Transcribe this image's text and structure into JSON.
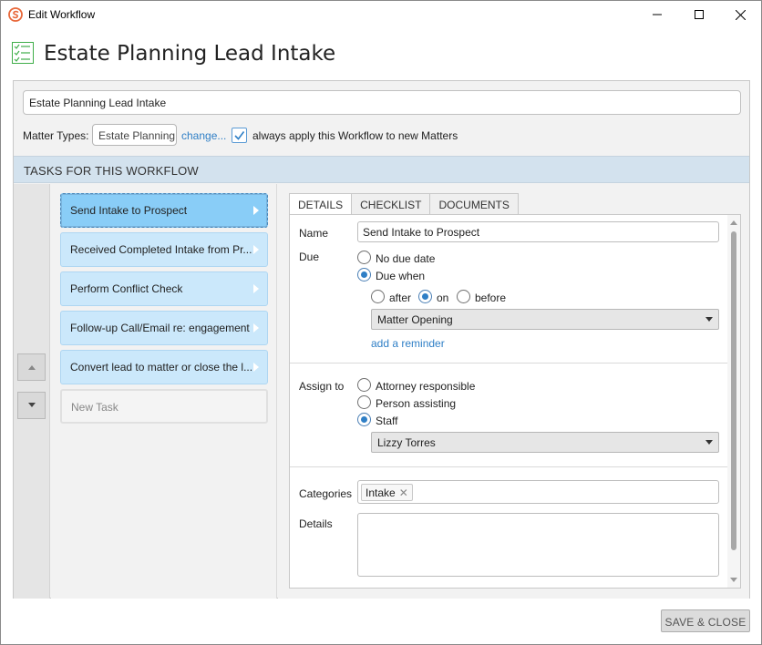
{
  "window": {
    "title": "Edit Workflow"
  },
  "header": {
    "title": "Estate Planning Lead Intake"
  },
  "workflow": {
    "name_value": "Estate Planning Lead Intake",
    "matter_types_label": "Matter Types:",
    "matter_types_value": "Estate Planning",
    "change_link": "change...",
    "always_apply_checked": true,
    "always_apply_label": "always apply this Workflow to new Matters"
  },
  "tasks_section": {
    "heading": "TASKS FOR THIS WORKFLOW",
    "tasks": [
      {
        "label": "Send Intake to Prospect",
        "selected": true
      },
      {
        "label": "Received Completed Intake from Pr...",
        "selected": false
      },
      {
        "label": "Perform Conflict Check",
        "selected": false
      },
      {
        "label": "Follow-up Call/Email re: engagement",
        "selected": false
      },
      {
        "label": "Convert lead to matter or close the l...",
        "selected": false
      }
    ],
    "new_task_label": "New Task"
  },
  "detail_tabs": [
    {
      "label": "DETAILS",
      "active": true
    },
    {
      "label": "CHECKLIST",
      "active": false
    },
    {
      "label": "DOCUMENTS",
      "active": false
    }
  ],
  "details": {
    "name_label": "Name",
    "name_value": "Send Intake to Prospect",
    "due_label": "Due",
    "no_due_date_label": "No due date",
    "due_when_label": "Due when",
    "after_label": "after",
    "on_label": "on",
    "before_label": "before",
    "due_event_value": "Matter Opening",
    "add_reminder_link": "add a reminder",
    "assign_to_label": "Assign to",
    "attorney_responsible_label": "Attorney responsible",
    "person_assisting_label": "Person assisting",
    "staff_label": "Staff",
    "staff_value": "Lizzy Torres",
    "categories_label": "Categories",
    "category_chip": "Intake",
    "details_label": "Details",
    "details_value": ""
  },
  "footer": {
    "save_close_label": "SAVE & CLOSE"
  },
  "colors": {
    "accent": "#2f7fc6",
    "task_bg": "#cbe8fb",
    "task_selected_bg": "#89cdf7",
    "section_bar": "#d3e2ee",
    "app_icon": "#e8683a",
    "header_icon": "#3fae49"
  },
  "icons": {
    "app": "app-logo-icon",
    "header": "checklist-icon",
    "move_up": "triangle-up-icon",
    "move_down": "triangle-down-icon"
  }
}
